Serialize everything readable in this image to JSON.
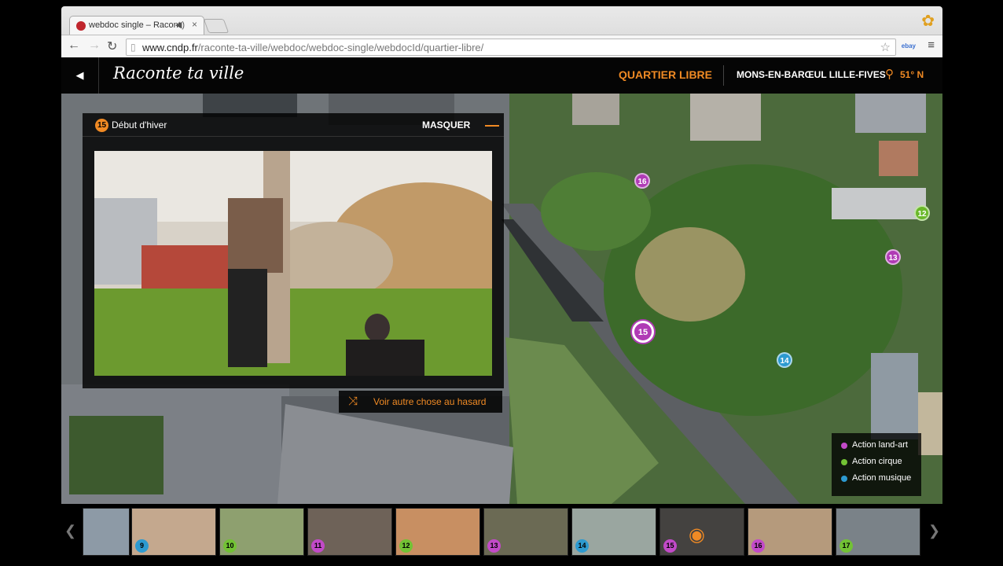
{
  "browser": {
    "tab_title": "webdoc single – Racont",
    "tab_close": "×",
    "url_host": "www.cndp.fr",
    "url_path": "/raconte-ta-ville/webdoc/webdoc-single/webdocId/quartier-libre/",
    "ext_label": "ebay"
  },
  "header": {
    "logo": "Raconte ta ville",
    "section": "QUARTIER LIBRE",
    "location": "MONS-EN-BARŒUL LILLE-FIVES",
    "coords": "51° N"
  },
  "panel": {
    "badge": "15",
    "title": "Début d'hiver",
    "hide_label": "MASQUER",
    "random_label": "Voir autre chose au hasard"
  },
  "map_markers": [
    {
      "id": "16",
      "color": "purple"
    },
    {
      "id": "12",
      "color": "green"
    },
    {
      "id": "13",
      "color": "purple"
    },
    {
      "id": "15",
      "color": "purple"
    },
    {
      "id": "14",
      "color": "blue"
    }
  ],
  "legend": [
    {
      "label": "Action land-art",
      "color": "#c24ac8"
    },
    {
      "label": "Action cirque",
      "color": "#72c234"
    },
    {
      "label": "Action musique",
      "color": "#2d9ad0"
    }
  ],
  "filmstrip": [
    {
      "badge": "",
      "color": ""
    },
    {
      "badge": "9",
      "color": "#2d9ad0"
    },
    {
      "badge": "10",
      "color": "#72c234"
    },
    {
      "badge": "11",
      "color": "#c24ac8"
    },
    {
      "badge": "12",
      "color": "#72c234"
    },
    {
      "badge": "13",
      "color": "#c24ac8"
    },
    {
      "badge": "14",
      "color": "#2d9ad0"
    },
    {
      "badge": "15",
      "color": "#c24ac8"
    },
    {
      "badge": "16",
      "color": "#c24ac8"
    },
    {
      "badge": "17",
      "color": "#72c234"
    }
  ]
}
